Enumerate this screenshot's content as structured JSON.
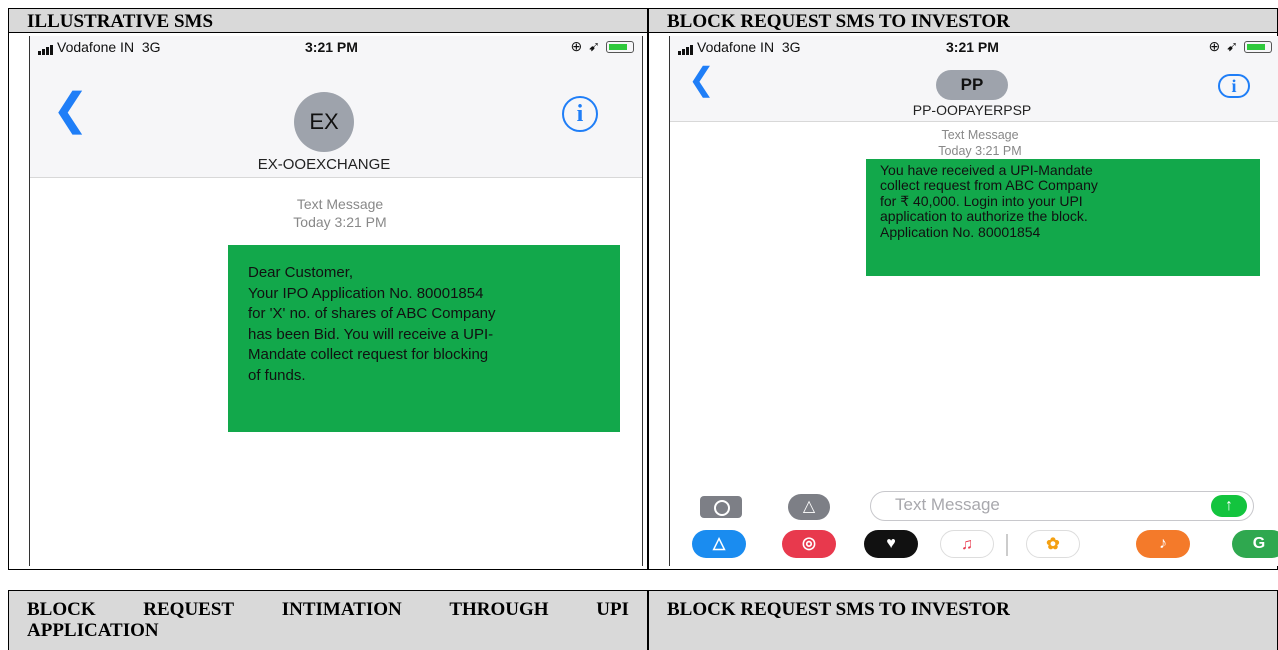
{
  "top_table": {
    "left_header": "ILLUSTRATIVE SMS",
    "right_header": "BLOCK REQUEST SMS TO INVESTOR"
  },
  "phone1": {
    "carrier": "Vodafone IN",
    "network": "3G",
    "time": "3:21 PM",
    "avatar": "EX",
    "contact": "EX-OOEXCHANGE",
    "message_type": "Text Message",
    "message_time": "Today 3:21 PM",
    "message_lines": [
      "Dear Customer,",
      "Your IPO Application No. 80001854",
      "for 'X' no. of shares of ABC Company",
      "has been Bid. You will receive a UPI-",
      "Mandate collect request for blocking",
      "of funds."
    ],
    "bubble_color": "#12a84b"
  },
  "phone2": {
    "carrier": "Vodafone IN",
    "network": "3G",
    "time": "3:21 PM",
    "avatar": "PP",
    "contact": "PP-OOPAYERPSP",
    "message_type": "Text Message",
    "message_time": "Today 3:21 PM",
    "message_lines": [
      "You have received a UPI-Mandate",
      "collect request from ABC Company",
      "for ₹ 40,000. Login into your UPI",
      "application to authorize the block.",
      "Application No. 80001854"
    ],
    "input_placeholder": "Text Message",
    "app_icons": [
      "app-store-icon",
      "search-globe-icon",
      "heart-icon",
      "music-icon",
      "photos-icon",
      "garageband-icon",
      "maps-icon"
    ]
  },
  "bottom_table": {
    "left_header_line1_words": [
      "BLOCK",
      "REQUEST",
      "INTIMATION",
      "THROUGH",
      "UPI"
    ],
    "left_header_line2": "APPLICATION",
    "right_header": "BLOCK REQUEST SMS TO INVESTOR"
  }
}
